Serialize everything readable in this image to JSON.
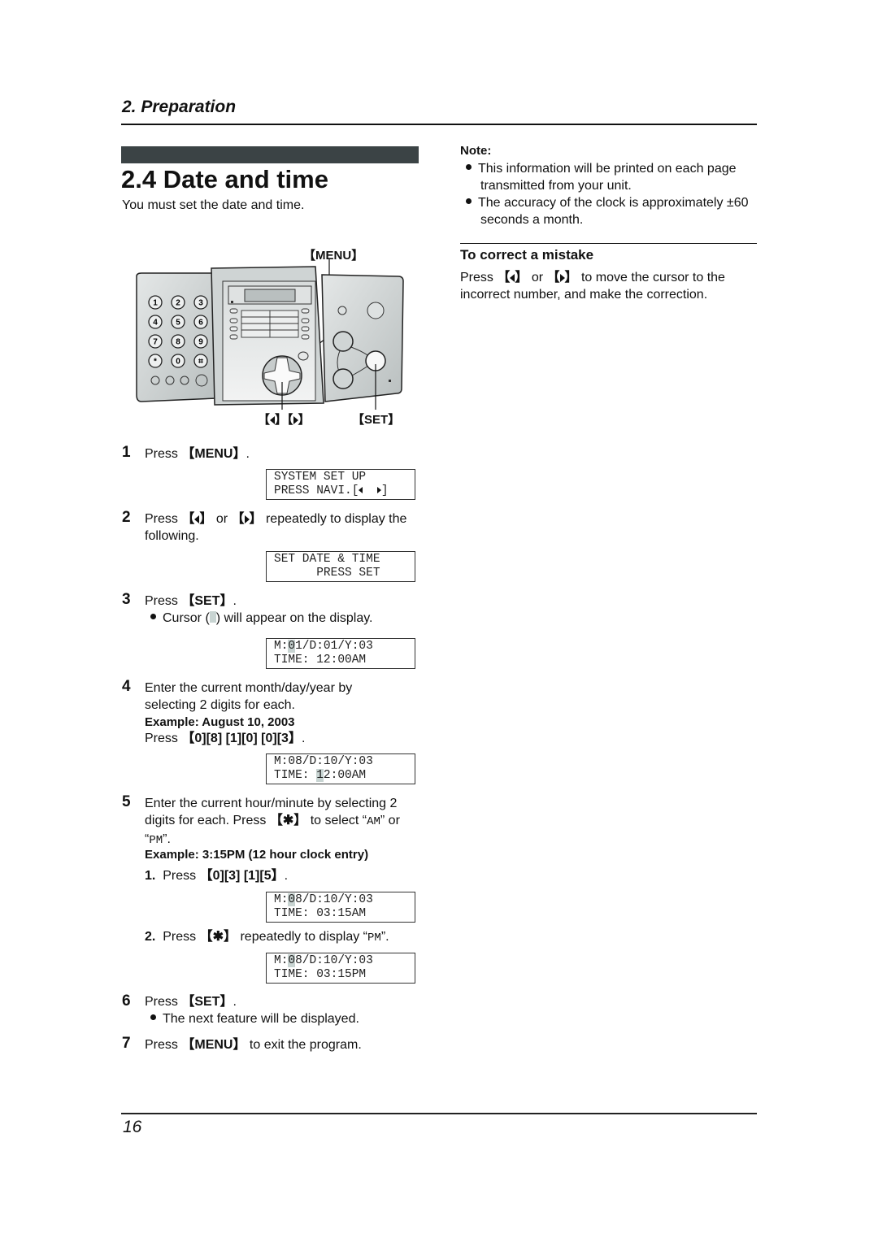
{
  "header": {
    "section": "2. Preparation"
  },
  "title": "2.4 Date and time",
  "intro": "You must set the date and time.",
  "figure": {
    "callout_menu": "MENU",
    "callout_set": "SET",
    "keypad": [
      "1",
      "2",
      "3",
      "4",
      "5",
      "6",
      "7",
      "8",
      "9",
      "*",
      "0",
      "#"
    ]
  },
  "steps": [
    {
      "num": "1",
      "pre": "Press ",
      "key": "MENU",
      "post": "."
    },
    {
      "num": "2",
      "pre": "Press ",
      "post": " repeatedly to display the following."
    },
    {
      "num": "3",
      "pre": "Press ",
      "key": "SET",
      "post": ".",
      "bullet": "Cursor (",
      "bullet_post": ") will appear on the display."
    },
    {
      "num": "4",
      "line1": "Enter the current month/day/year by",
      "line2": "selecting 2 digits for each.",
      "example": "Example: August 10, 2003",
      "press_pre": "Press ",
      "press_keys": "0][8] [1][0] [0][3"
    },
    {
      "num": "5",
      "line1": "Enter the current hour/minute by selecting 2",
      "line2_pre": "digits for each. Press ",
      "line2_mid": " to select “",
      "am": "AM",
      "line2_or": "” or",
      "pm_open": "“",
      "pm": "PM",
      "pm_close": "”.",
      "example": "Example: 3:15PM (12 hour clock entry)",
      "sub1_num": "1.",
      "sub1_pre": "Press ",
      "sub1_keys": "0][3] [1][5",
      "sub2_num": "2.",
      "sub2_pre": "Press ",
      "sub2_post": " repeatedly to display “",
      "sub2_pm": "PM",
      "sub2_end": "”."
    },
    {
      "num": "6",
      "pre": "Press ",
      "key": "SET",
      "post": ".",
      "bullet": "The next feature will be displayed."
    },
    {
      "num": "7",
      "pre": "Press ",
      "key": "MENU",
      "post": " to exit the program."
    }
  ],
  "displays": [
    {
      "line1": "SYSTEM SET UP",
      "line2": "PRESS NAVI.["
    },
    {
      "line1": "SET DATE & TIME",
      "line2": "      PRESS SET"
    },
    {
      "l1a": "M:",
      "l1c": "0",
      "l1b": "1/D:01/Y:03",
      "line2": "TIME: 12:00AM"
    },
    {
      "line1": "M:08/D:10/Y:03",
      "l2a": "TIME: ",
      "l2c": "1",
      "l2b": "2:00AM"
    },
    {
      "l1a": "M:",
      "l1c": "0",
      "l1b": "8/D:10/Y:03",
      "line2": "TIME: 03:15AM"
    },
    {
      "l1a": "M:",
      "l1c": "0",
      "l1b": "8/D:10/Y:03",
      "line2": "TIME: 03:15PM"
    }
  ],
  "note": {
    "label": "Note:",
    "items": [
      "This information will be printed on each page transmitted from your unit.",
      "The accuracy of the clock is approximately ±60 seconds a month."
    ]
  },
  "correct": {
    "heading": "To correct a mistake",
    "pre": "Press ",
    "or": " or ",
    "post": " to move the cursor to the incorrect number, and make the correction."
  },
  "footer": {
    "page_number": "16"
  }
}
